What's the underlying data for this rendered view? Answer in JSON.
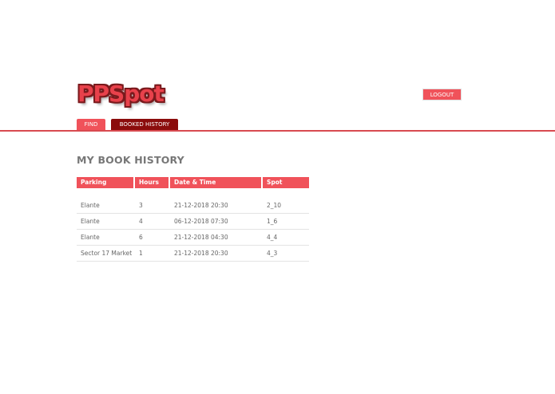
{
  "brand": {
    "logo_text": "PPSpot"
  },
  "header": {
    "logout_label": "LOGOUT"
  },
  "nav": {
    "tabs": [
      {
        "label": "FIND",
        "active": false
      },
      {
        "label": "BOOKED HISTORY",
        "active": true
      }
    ]
  },
  "main": {
    "title": "MY BOOK HISTORY",
    "table": {
      "columns": [
        "Parking",
        "Hours",
        "Date & Time",
        "Spot"
      ],
      "rows": [
        [
          "Elante",
          "3",
          "21-12-2018 20:30",
          "2_10"
        ],
        [
          "Elante",
          "4",
          "06-12-2018 07:30",
          "1_6"
        ],
        [
          "Elante",
          "6",
          "21-12-2018 04:30",
          "4_4"
        ],
        [
          "Sector 17 Market",
          "1",
          "21-12-2018 20:30",
          "4_3"
        ]
      ]
    }
  },
  "colors": {
    "accent": "#f0525a",
    "active_tab": "#8b0c0c",
    "heading": "#777777"
  }
}
